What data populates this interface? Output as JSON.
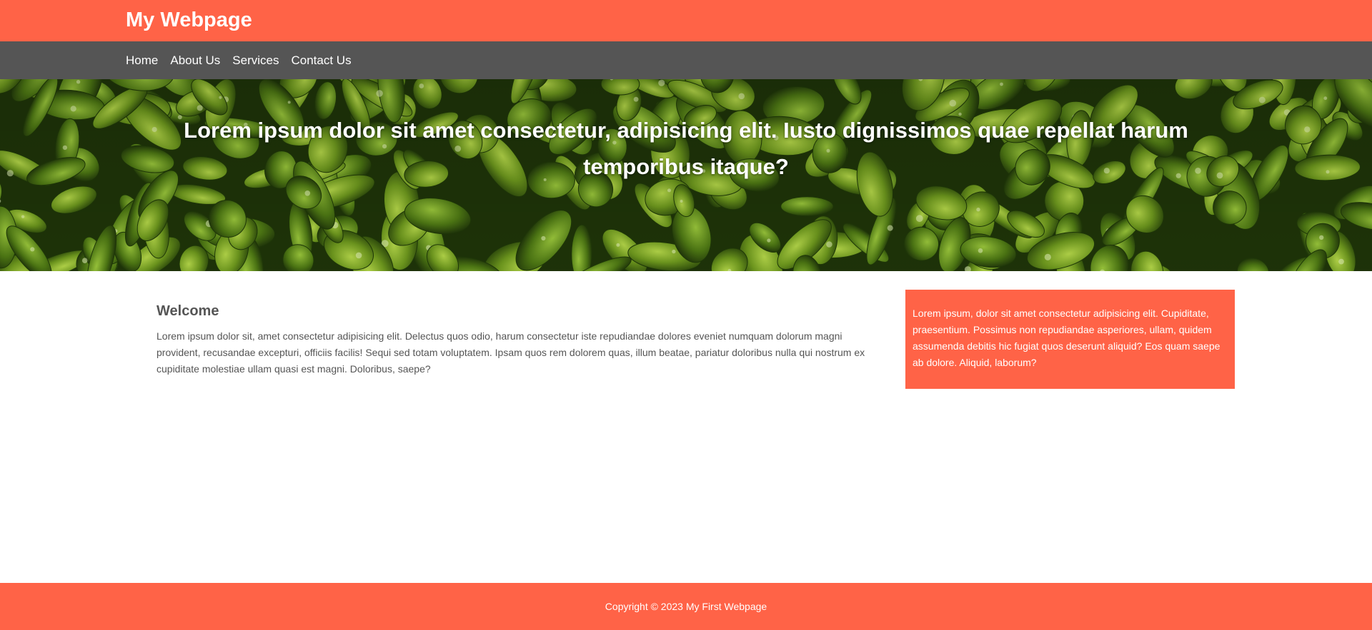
{
  "header": {
    "site_title": "My Webpage"
  },
  "nav": {
    "items": [
      {
        "label": "Home"
      },
      {
        "label": "About Us"
      },
      {
        "label": "Services"
      },
      {
        "label": "Contact Us"
      }
    ]
  },
  "hero": {
    "heading": "Lorem ipsum dolor sit amet consectetur, adipisicing elit. Iusto dignissimos quae repellat harum temporibus itaque?",
    "background": "leaves-image"
  },
  "main": {
    "welcome_title": "Welcome",
    "welcome_text": "Lorem ipsum dolor sit, amet consectetur adipisicing elit. Delectus quos odio, harum consectetur iste repudiandae dolores eveniet numquam dolorum magni provident, recusandae excepturi, officiis facilis! Sequi sed totam voluptatem. Ipsam quos rem dolorem quas, illum beatae, pariatur doloribus nulla qui nostrum ex cupiditate molestiae ullam quasi est magni. Doloribus, saepe?",
    "aside_text": "Lorem ipsum, dolor sit amet consectetur adipisicing elit. Cupiditate, praesentium. Possimus non repudiandae asperiores, ullam, quidem assumenda debitis hic fugiat quos deserunt aliquid? Eos quam saepe ab dolore. Aliquid, laborum?"
  },
  "footer": {
    "copyright": "Copyright © 2023 My First Webpage"
  },
  "colors": {
    "accent": "#ff6347",
    "nav_bg": "#555555",
    "text": "#555555",
    "white": "#ffffff"
  }
}
